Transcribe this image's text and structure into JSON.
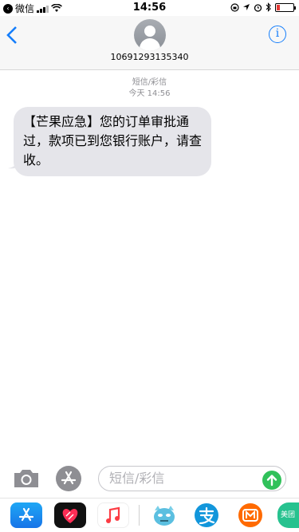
{
  "status_bar": {
    "carrier_label": "微信",
    "time": "14:56"
  },
  "contact": {
    "number": "10691293135340"
  },
  "thread": {
    "service_label": "短信/彩信",
    "timestamp": "今天 14:56"
  },
  "messages": [
    {
      "text": "【芒果应急】您的订单审批通过，款项已到您银行账户，请查收。"
    }
  ],
  "composer": {
    "placeholder": "短信/彩信"
  },
  "colors": {
    "accent": "#157efb",
    "bubble_incoming": "#e5e5ea",
    "send": "#30c15a"
  },
  "app_drawer": {
    "icons": [
      "app-store-icon",
      "heart-digital-touch-icon",
      "music-icon",
      "monster-sticker-icon",
      "alipay-icon",
      "mango-tv-icon",
      "meituan-icon"
    ],
    "meituan_label": "美团"
  }
}
